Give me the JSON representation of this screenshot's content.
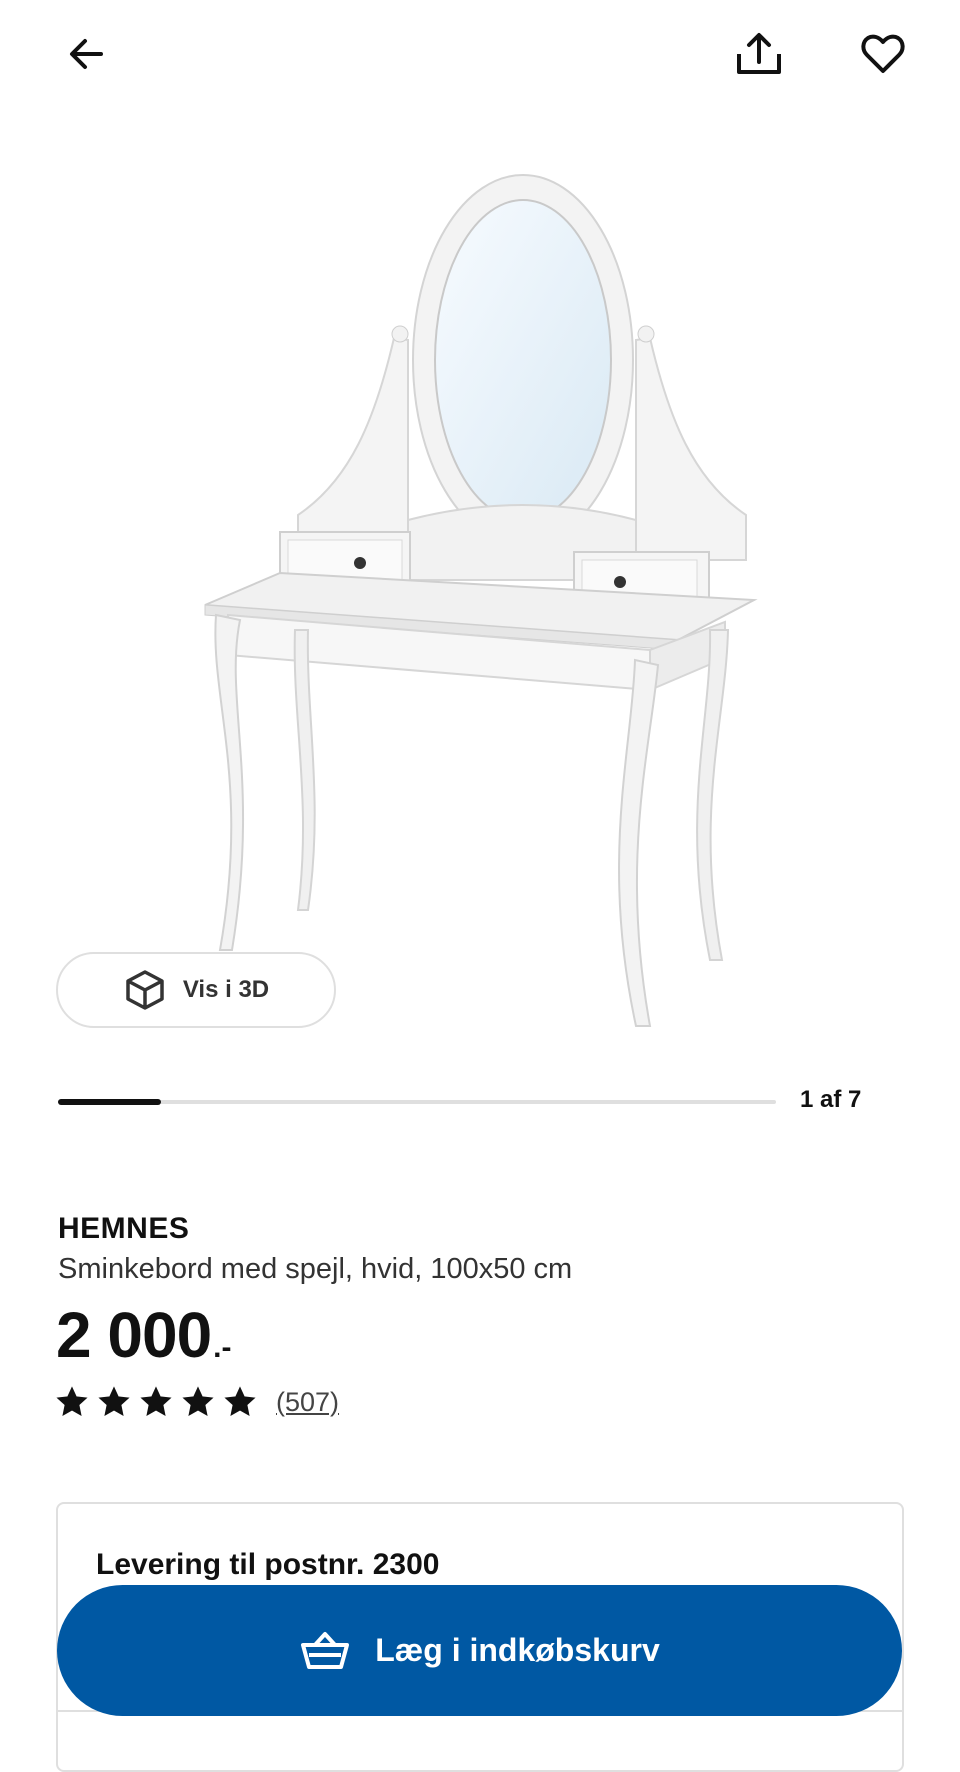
{
  "header": {
    "back_icon": "arrow-left-icon",
    "share_icon": "share-icon",
    "favorite_icon": "heart-icon"
  },
  "gallery": {
    "view_3d_label": "Vis i 3D",
    "view_3d_icon": "cube-icon",
    "counter": "1 af 7",
    "current_index": 1,
    "total_images": 7
  },
  "product": {
    "brand": "HEMNES",
    "description": "Sminkebord med spejl, hvid, 100x50 cm",
    "price": "2 000",
    "price_suffix": ".-",
    "rating": 5,
    "review_count": "(507)"
  },
  "delivery": {
    "title": "Levering til postnr. 2300"
  },
  "cart": {
    "label": "Læg i indkøbskurv",
    "icon": "basket-icon"
  },
  "colors": {
    "primary_blue": "#0058a3",
    "text": "#111111",
    "border": "#dfdfdf"
  }
}
